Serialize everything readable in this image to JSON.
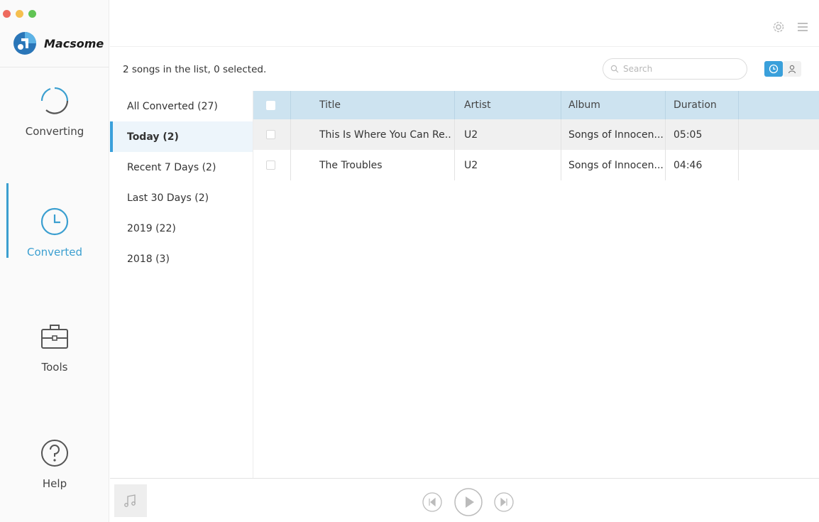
{
  "window": {
    "controls": [
      "close",
      "minimize",
      "zoom"
    ]
  },
  "brand": {
    "name": "Macsome",
    "logo_icon": "macsome-logo-icon"
  },
  "nav": [
    {
      "id": "converting",
      "label": "Converting",
      "icon": "refresh-circle-icon",
      "active": false
    },
    {
      "id": "converted",
      "label": "Converted",
      "icon": "clock-icon",
      "active": true
    },
    {
      "id": "tools",
      "label": "Tools",
      "icon": "toolbox-icon",
      "active": false
    },
    {
      "id": "help",
      "label": "Help",
      "icon": "question-circle-icon",
      "active": false
    }
  ],
  "toolbar": {
    "settings_icon": "gear-icon",
    "menu_icon": "hamburger-menu-icon"
  },
  "list_status": "2 songs in the list, 0 selected.",
  "search": {
    "placeholder": "Search",
    "value": ""
  },
  "view_toggle": {
    "options": [
      "clock-icon",
      "person-icon"
    ],
    "selected": "clock-icon"
  },
  "categories": [
    {
      "label": "All Converted (27)",
      "selected": false
    },
    {
      "label": "Today (2)",
      "selected": true
    },
    {
      "label": "Recent 7 Days (2)",
      "selected": false
    },
    {
      "label": "Last 30 Days (2)",
      "selected": false
    },
    {
      "label": "2019 (22)",
      "selected": false
    },
    {
      "label": "2018 (3)",
      "selected": false
    }
  ],
  "table": {
    "columns": [
      "Title",
      "Artist",
      "Album",
      "Duration"
    ],
    "rows": [
      {
        "title": "This Is Where You Can Re...",
        "artist": "U2",
        "album": "Songs of Innocen...",
        "duration": "05:05"
      },
      {
        "title": "The Troubles",
        "artist": "U2",
        "album": "Songs of Innocen...",
        "duration": "04:46"
      }
    ]
  },
  "player": {
    "buttons": [
      "previous-icon",
      "play-icon",
      "next-icon"
    ],
    "music_icon": "music-note-icon"
  },
  "colors": {
    "accent": "#3aa0db",
    "header_bg": "#cde3f0"
  }
}
